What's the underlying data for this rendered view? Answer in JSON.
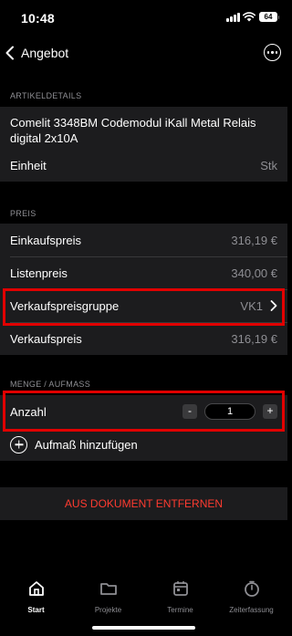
{
  "status_bar": {
    "time": "10:48",
    "battery": "64"
  },
  "nav": {
    "back_label": "Angebot"
  },
  "sections": {
    "article": {
      "header": "ARTIKELDETAILS",
      "title": "Comelit 3348BM Codemodul iKall Metal Relais digital 2x10A",
      "unit_label": "Einheit",
      "unit_value": "Stk"
    },
    "price": {
      "header": "PREIS",
      "purchase_label": "Einkaufspreis",
      "purchase_value": "316,19 €",
      "list_label": "Listenpreis",
      "list_value": "340,00 €",
      "group_label": "Verkaufspreisgruppe",
      "group_value": "VK1",
      "sale_label": "Verkaufspreis",
      "sale_value": "316,19 €"
    },
    "quantity": {
      "header": "MENGE / AUFMASS",
      "count_label": "Anzahl",
      "count_value": "1",
      "minus": "-",
      "plus": "+",
      "add_label": "Aufmaß hinzufügen"
    }
  },
  "remove_label": "AUS DOKUMENT ENTFERNEN",
  "tabs": [
    {
      "label": "Start",
      "icon": "home-icon",
      "active": true
    },
    {
      "label": "Projekte",
      "icon": "folder-icon",
      "active": false
    },
    {
      "label": "Termine",
      "icon": "calendar-icon",
      "active": false
    },
    {
      "label": "Zeiterfassung",
      "icon": "timer-icon",
      "active": false
    }
  ],
  "colors": {
    "background": "#000000",
    "cell": "#1c1c1e",
    "highlight": "#e10000",
    "destructive": "#ff3b30",
    "secondary_text": "#8e8e93"
  }
}
